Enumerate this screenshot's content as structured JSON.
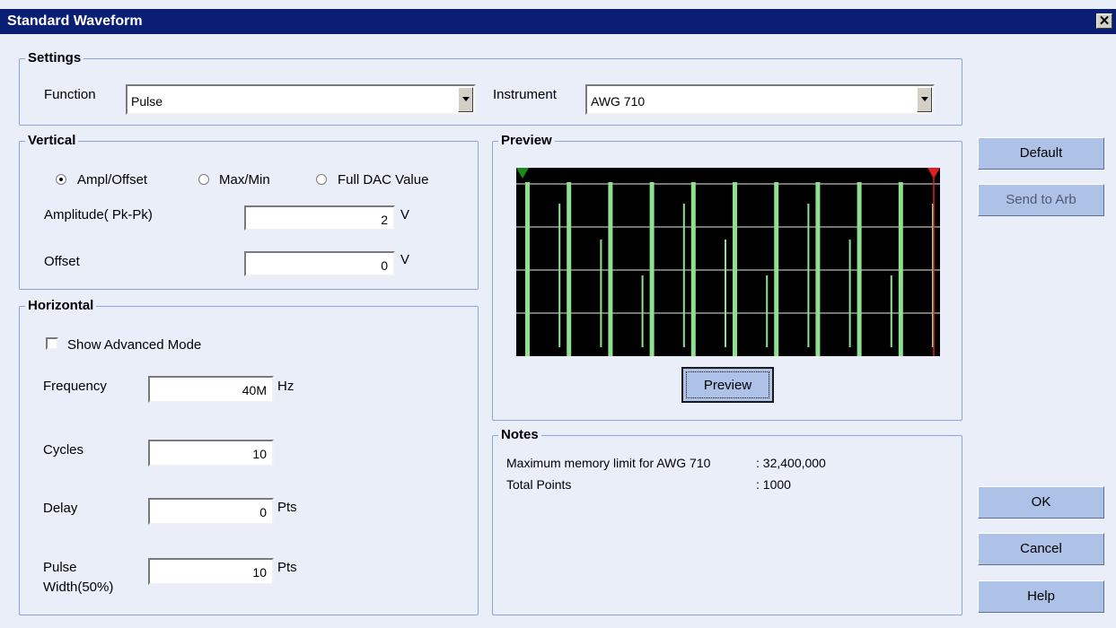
{
  "window": {
    "title": "Standard Waveform",
    "close_glyph": "✕"
  },
  "settings": {
    "legend": "Settings",
    "function_label": "Function",
    "function_value": "Pulse",
    "instrument_label": "Instrument",
    "instrument_value": "AWG 710"
  },
  "vertical": {
    "legend": "Vertical",
    "modes": [
      "Ampl/Offset",
      "Max/Min",
      "Full DAC Value"
    ],
    "selected_mode": "Ampl/Offset",
    "amplitude_label": "Amplitude( Pk-Pk)",
    "amplitude_value": "2",
    "amplitude_unit": "V",
    "offset_label": "Offset",
    "offset_value": "0",
    "offset_unit": "V"
  },
  "horizontal": {
    "legend": "Horizontal",
    "advanced_label": "Show Advanced Mode",
    "advanced_checked": false,
    "frequency_label": "Frequency",
    "frequency_value": "40M",
    "frequency_unit": "Hz",
    "cycles_label": "Cycles",
    "cycles_value": "10",
    "delay_label": "Delay",
    "delay_value": "0",
    "delay_unit": "Pts",
    "pulse_label_1": "Pulse",
    "pulse_label_2": "Width(50%)",
    "pulse_value": "10",
    "pulse_unit": "Pts"
  },
  "preview": {
    "legend": "Preview",
    "button_label": "Preview",
    "waveform_color": "#8fe08f",
    "background_color": "#000000",
    "start_marker_color": "#1a8a1a",
    "end_marker_color": "#e02020",
    "cycles": 10
  },
  "notes": {
    "legend": "Notes",
    "line1_label": "Maximum memory limit for AWG 710",
    "line1_value": ": 32,400,000",
    "line2_label": "Total Points",
    "line2_value": ": 1000"
  },
  "buttons": {
    "default": "Default",
    "send_to_arb": "Send to Arb",
    "ok": "OK",
    "cancel": "Cancel",
    "help": "Help"
  }
}
